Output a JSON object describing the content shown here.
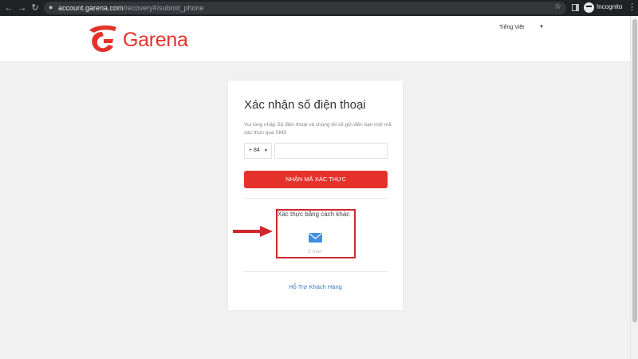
{
  "browser": {
    "url_host": "account.garena.com",
    "url_path": "/recovery#/submit_phone",
    "profile_label": "Incognito"
  },
  "header": {
    "logo_text": "Garena",
    "language": "Tiếng Việt"
  },
  "card": {
    "title": "Xác nhận số điện thoại",
    "description": "Vui lòng nhập Số điện thoại và chúng tôi sẽ gửi đến bạn một mã xác thực qua SMS",
    "country_code": "+ 84",
    "phone_value": "",
    "submit_label": "NHẬN MÃ XÁC THỰC",
    "alt_title": "Xác thực bằng cách khác",
    "email_label": "E-mail",
    "support_link": "Hỗ Trợ Khách Hàng"
  },
  "colors": {
    "brand_red": "#e4322b",
    "link_blue": "#3a78c8",
    "annotation_red": "#d0272e"
  },
  "icons": {
    "mail": "mail-icon",
    "arrow": "arrow-right-icon"
  }
}
